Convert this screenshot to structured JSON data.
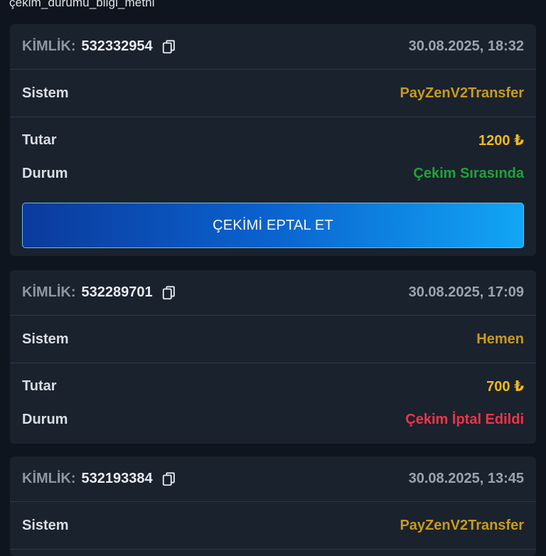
{
  "top_note": "çekim_durumu_bilgi_metni",
  "labels": {
    "id": "KİMLİK:",
    "system": "Sistem",
    "amount": "Tutar",
    "status": "Durum"
  },
  "cards": [
    {
      "id": "532332954",
      "datetime": "30.08.2025, 18:32",
      "system": "PayZenV2Transfer",
      "amount": "1200 ₺",
      "status": "Çekim Sırasında",
      "button": "ÇEKİMİ EPTAL ET"
    },
    {
      "id": "532289701",
      "datetime": "30.08.2025, 17:09",
      "system": "Hemen",
      "amount": "700 ₺",
      "status": "Çekim İptal Edildi"
    },
    {
      "id": "532193384",
      "datetime": "30.08.2025, 13:45",
      "system": "PayZenV2Transfer"
    }
  ],
  "colors": {
    "background": "#0f151e",
    "card": "#1a222d",
    "system": "#c99a1c",
    "amount": "#f0b922",
    "status_pending": "#1fa33a",
    "status_cancelled": "#f0334a"
  },
  "icons": {
    "copy": "copy-icon"
  }
}
